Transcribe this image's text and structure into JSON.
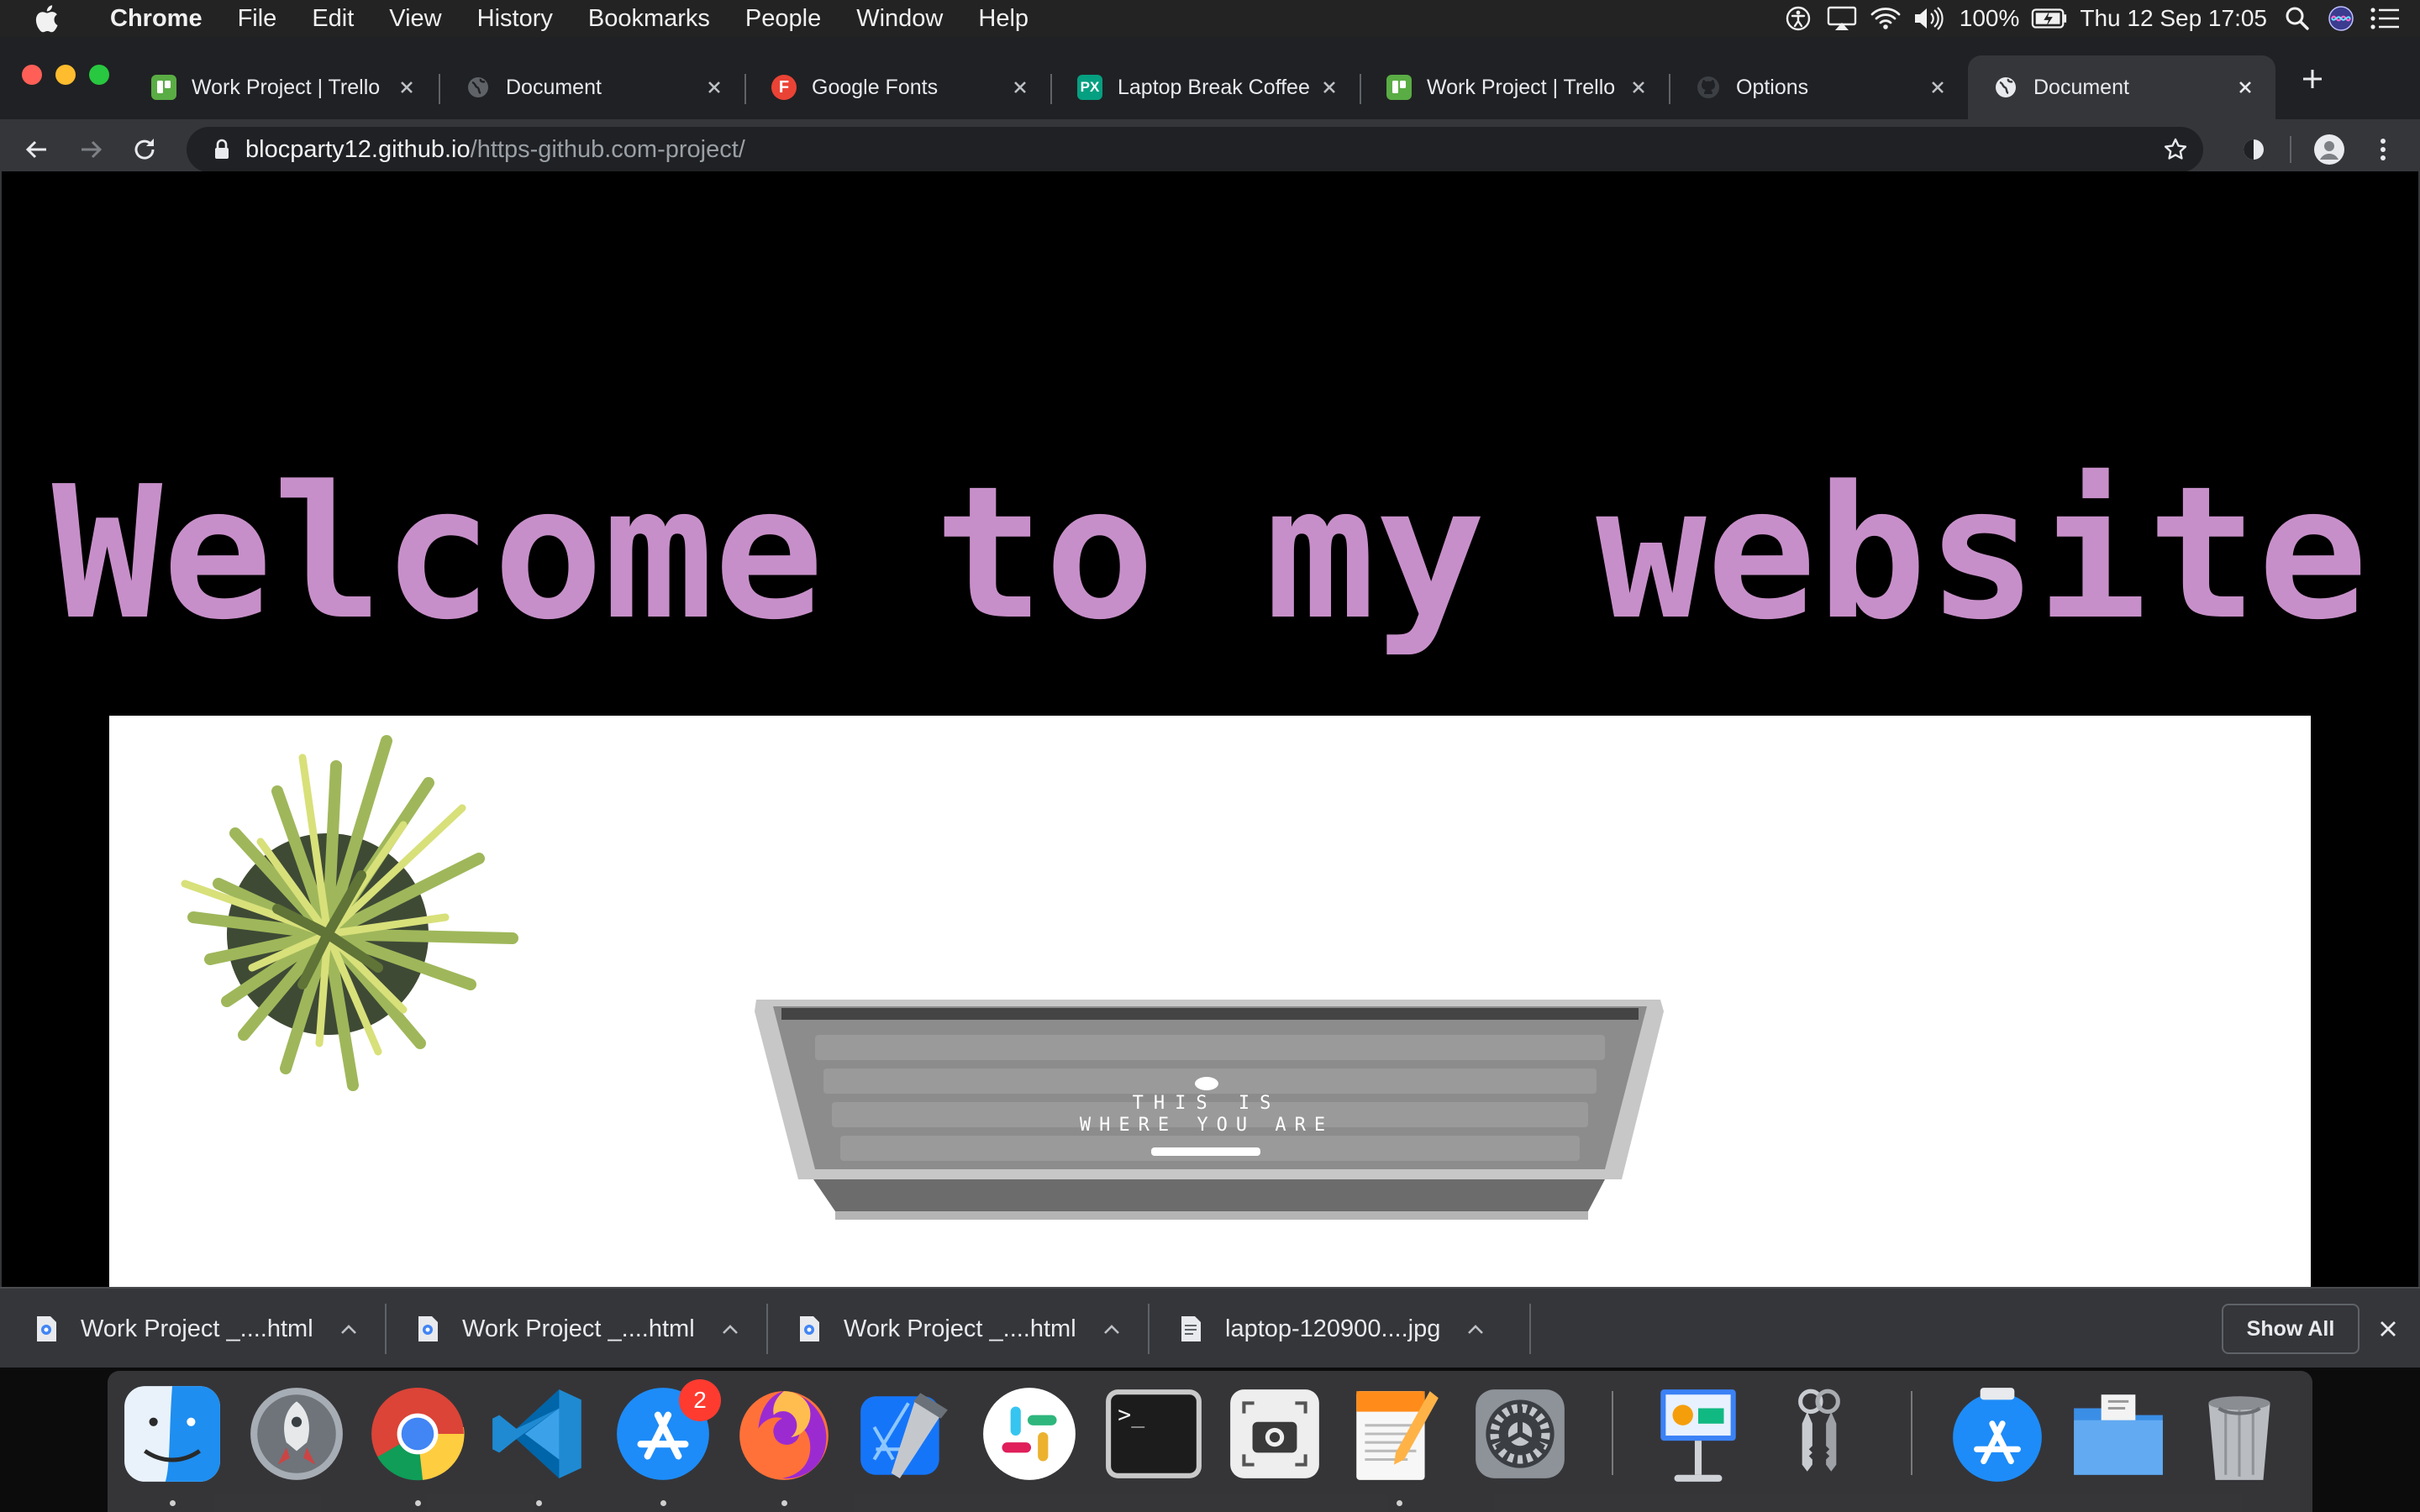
{
  "menubar": {
    "app_name": "Chrome",
    "items": [
      "File",
      "Edit",
      "View",
      "History",
      "Bookmarks",
      "People",
      "Window",
      "Help"
    ],
    "battery": "100%",
    "clock": "Thu 12 Sep  17:05"
  },
  "tabs": [
    {
      "title": "Work Project | Trello",
      "favicon": "trello-icon",
      "color": "#5aac44"
    },
    {
      "title": "Document",
      "favicon": "globe-icon",
      "color": "#5f6368"
    },
    {
      "title": "Google Fonts",
      "favicon": "google-fonts-icon",
      "letter": "F",
      "color": "#ea4335"
    },
    {
      "title": "Laptop Break Coffee",
      "favicon": "pexels-icon",
      "letter": "PX",
      "color": "#05a081"
    },
    {
      "title": "Work Project | Trello",
      "favicon": "trello-icon",
      "color": "#5aac44"
    },
    {
      "title": "Options",
      "favicon": "github-icon",
      "color": "#24292e"
    },
    {
      "title": "Document",
      "favicon": "globe-icon",
      "color": "#9aa0a6",
      "active": true
    }
  ],
  "address_bar": {
    "host": "blocparty12.github.io",
    "path": "/https-github.com-project/"
  },
  "page": {
    "heading": "Welcome to my website",
    "heading_color": "#c78fc9",
    "laptop_screen_text": [
      "THIS IS",
      "WHERE YOU ARE"
    ]
  },
  "downloads": {
    "items": [
      {
        "name": "Work Project _....html"
      },
      {
        "name": "Work Project _....html"
      },
      {
        "name": "Work Project _....html"
      },
      {
        "name": "laptop-120900....jpg"
      }
    ],
    "show_all_label": "Show All"
  },
  "dock": {
    "apps": [
      "finder-icon",
      "launchpad-icon",
      "chrome-icon",
      "vscode-icon",
      "app-store-icon",
      "firefox-icon",
      "xcode-icon",
      "slack-icon",
      "terminal-icon",
      "screenshot-icon",
      "pages-icon",
      "system-preferences-icon",
      "keynote-icon",
      "keychain-icon",
      "app-store-downloads-icon",
      "folder-icon",
      "trash-icon"
    ],
    "app_store_badge": "2",
    "terminal_prompt": ">_"
  }
}
